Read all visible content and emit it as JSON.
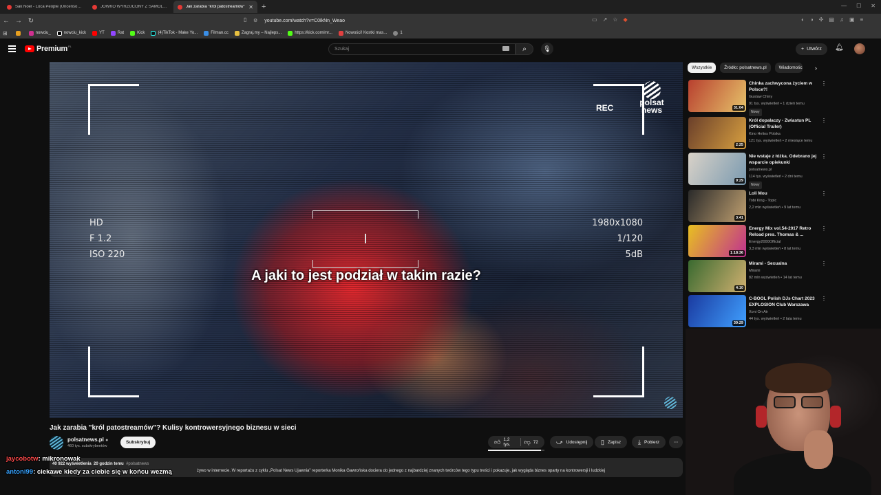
{
  "browser": {
    "tabs": [
      {
        "label": "Sak Noel - Loca People (Uncensored)",
        "active": false
      },
      {
        "label": "JÓWKO WYRZUCONY Z SAMOLOTU",
        "active": false
      },
      {
        "label": "Jak zarabia \"król patostreamów\"",
        "active": true
      }
    ],
    "url": "youtube.com/watch?v=C0ikNn_Weao",
    "bookmarks": [
      "nowciu_",
      "nowciu_kick",
      "YT",
      "Rat",
      "Kick",
      "(4)TikTok - Make Yo...",
      "Filman.cc",
      "Zagraj.my – Najleps...",
      "https://kick.com/mr...",
      "Nowości! Kostki mas...",
      "1"
    ]
  },
  "youtube": {
    "logo_text": "Premium",
    "logo_region": "PL",
    "search_placeholder": "Szukaj",
    "create_label": "Utwórz"
  },
  "player": {
    "hud_left": [
      "HD",
      "F 1.2",
      "ISO 220"
    ],
    "hud_right": [
      "1980x1080",
      "1/120",
      "5dB"
    ],
    "rec_label": "REC",
    "brand_line1": "polsat",
    "brand_line2": "news",
    "subtitle": "A jaki to jest podział w takim razie?"
  },
  "video": {
    "title": "Jak zarabia \"król patostreamów\"? Kulisy kontrowersyjnego biznesu w sieci",
    "channel": "polsatnews.pl",
    "subscribers": "460 tys. subskrybentów",
    "subscribe_label": "Subskrybuj",
    "likes": "1,2 tys.",
    "dislikes": "72",
    "like_ratio": 0.94,
    "share_label": "Udostępnij",
    "save_label": "Zapisz",
    "download_label": "Pobierz",
    "views": "40 922 wyświetlenia",
    "age": "20 godzin temu",
    "hashtag": "#polsatnews",
    "description": "żywo w internecie. W reportażu z cyklu „Polsat News Ujawnia\" reporterka Monika Gawrońska dociera do jednego z najbardziej znanych twórców tego typu treści i pokazuje, jak wygląda biznes oparty na kontrowersji i ludzkiej"
  },
  "chat": [
    {
      "user": "jaycobotw",
      "message": ": mikronowak"
    },
    {
      "user": "antoni99",
      "message": ": ciekawe kiedy za ciebie się w końcu wezmą"
    }
  ],
  "sidebar": {
    "chips": [
      "Wszystkie",
      "Źródło: polsatnews.pl",
      "Wiadomości"
    ],
    "items": [
      {
        "title": "Chinka zachwycona życiem w Polsce?!",
        "channel": "Gustaw Chiny",
        "meta": "91 tys. wyświetleń • 1 dzień temu",
        "badge": "Nowy",
        "duration": "31:04",
        "c1": "#b8402f",
        "c2": "#e6c36a"
      },
      {
        "title": "Król dopalaczy - Zwiastun PL (Official Trailer)",
        "channel": "Kino Helios Polska",
        "meta": "121 tys. wyświetleń • 2 miesiące temu",
        "badge": "",
        "duration": "2:25",
        "c1": "#6a3f2a",
        "c2": "#d8a040"
      },
      {
        "title": "Nie wstaje z łóżka. Odebrano jej wsparcie opiekunki",
        "channel": "polsatnews.pl",
        "meta": "114 tys. wyświetleń • 2 dni temu",
        "badge": "Nowy",
        "duration": "9:29",
        "c1": "#d9d2c8",
        "c2": "#7a9ab0"
      },
      {
        "title": "Loli Mou",
        "channel": "Tobi King - Topic",
        "meta": "2,2 mln wyświetleń • 9 lat temu",
        "badge": "",
        "duration": "3:41",
        "c1": "#2a2a2a",
        "c2": "#c0a070"
      },
      {
        "title": "Energy Mix vol.54-2017 Retro Reload pres. Thomas & ...",
        "channel": "Energy2000Official",
        "meta": "3,3 mln wyświetleń • 8 lat temu",
        "badge": "",
        "duration": "1:18:36",
        "c1": "#e8c020",
        "c2": "#c03090"
      },
      {
        "title": "Mirami - Sexualna",
        "channel": "Mirami",
        "meta": "82 mln wyświetleń • 14 lat temu",
        "badge": "",
        "duration": "4:10",
        "c1": "#3a6a30",
        "c2": "#d0b070"
      },
      {
        "title": "C-BOOL Polish DJs Chart 2023 EXPLOSION Club Warszawa",
        "channel": "Xoni On Air",
        "meta": "44 tys. wyświetleń • 2 lata temu",
        "badge": "",
        "duration": "39:29",
        "c1": "#1a3aa0",
        "c2": "#40a0ff"
      }
    ]
  }
}
